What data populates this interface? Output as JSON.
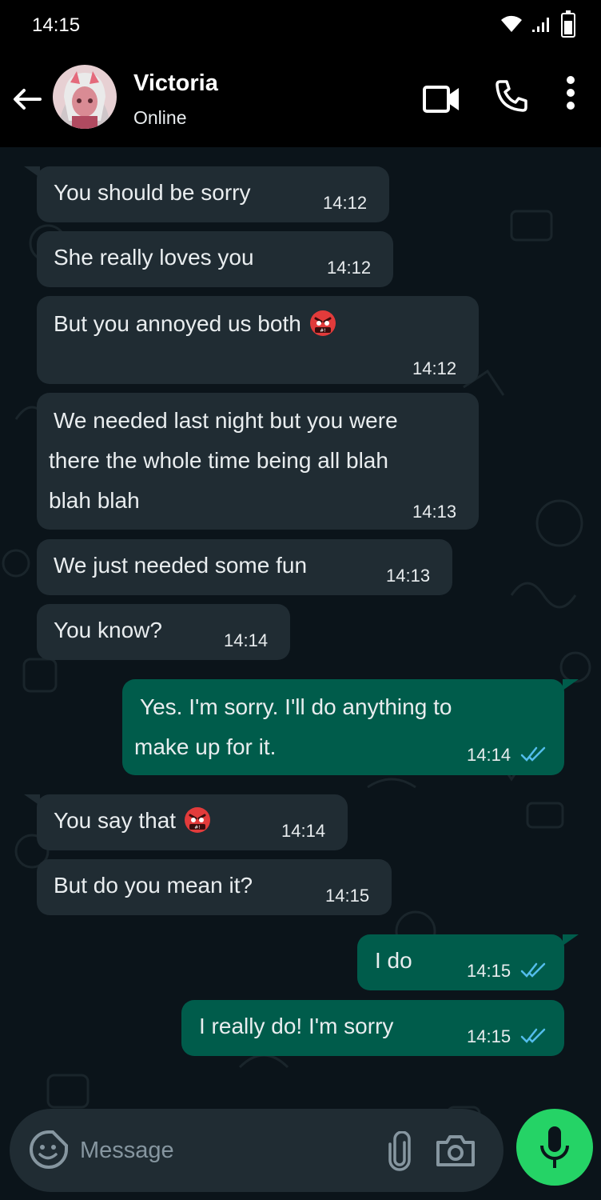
{
  "status_bar": {
    "time": "14:15"
  },
  "header": {
    "contact_name": "Victoria",
    "presence": "Online"
  },
  "messages": [
    {
      "dir": "in",
      "text": "You should be sorry",
      "time": "14:12"
    },
    {
      "dir": "in",
      "text": "She really loves you",
      "time": "14:12"
    },
    {
      "dir": "in",
      "text": "But you annoyed us both",
      "emoji": "angry-face-with-symbols",
      "time": "14:12"
    },
    {
      "dir": "in",
      "lines": [
        "We needed last night but you were",
        "there the whole time being all blah",
        "blah blah"
      ],
      "time": "14:13"
    },
    {
      "dir": "in",
      "text": "We just needed some fun",
      "time": "14:13"
    },
    {
      "dir": "in",
      "text": "You know?",
      "time": "14:14"
    },
    {
      "dir": "out",
      "lines": [
        "Yes. I'm sorry. I'll do anything to",
        "make up for it."
      ],
      "time": "14:14",
      "status": "read"
    },
    {
      "dir": "in",
      "text": "You say that",
      "emoji": "angry-face-with-symbols",
      "time": "14:14"
    },
    {
      "dir": "in",
      "text": "But do you mean it?",
      "time": "14:15"
    },
    {
      "dir": "out",
      "text": "I do",
      "time": "14:15",
      "status": "read"
    },
    {
      "dir": "out",
      "text": "I really do! I'm sorry",
      "time": "14:15",
      "status": "read"
    }
  ],
  "composer": {
    "placeholder": "Message"
  },
  "colors": {
    "chat_bg": "#0b141a",
    "incoming_bubble": "#202c33",
    "outgoing_bubble": "#005c4b",
    "mic_button": "#25d366",
    "read_tick": "#53bdeb"
  },
  "icons": [
    "wifi-icon",
    "signal-icon",
    "battery-icon",
    "back-arrow-icon",
    "video-call-icon",
    "voice-call-icon",
    "more-options-icon",
    "sticker-icon",
    "attach-icon",
    "camera-icon",
    "mic-icon"
  ]
}
